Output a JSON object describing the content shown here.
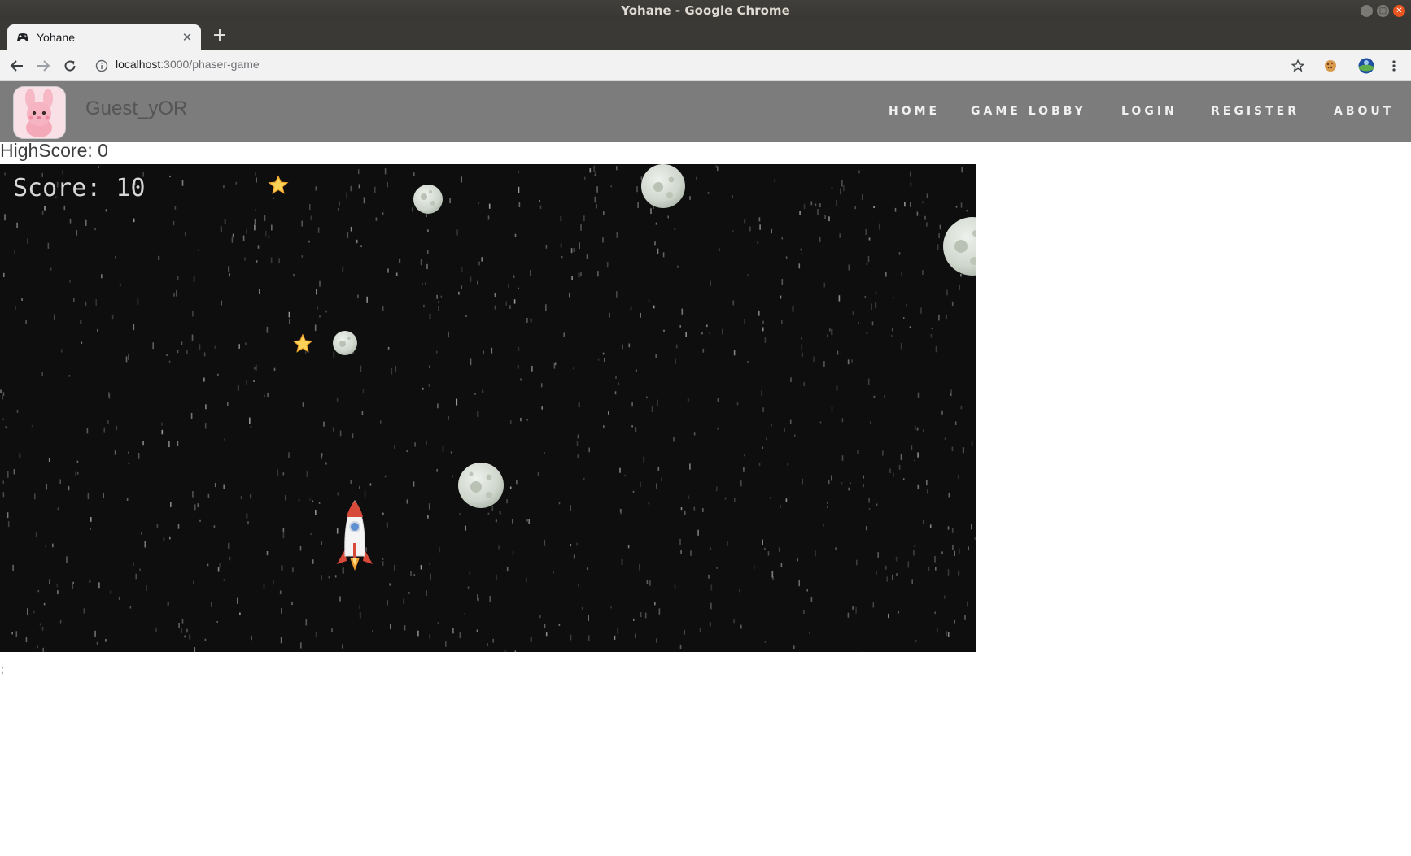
{
  "window": {
    "title": "Yohane - Google Chrome"
  },
  "browser": {
    "tab_title": "Yohane",
    "url_host": "localhost",
    "url_path": ":3000/phaser-game"
  },
  "site": {
    "username": "Guest_yOR",
    "nav": [
      "HOME",
      "GAME LOBBY",
      "LOGIN",
      "REGISTER",
      "ABOUT"
    ]
  },
  "page": {
    "highscore_label": "HighScore: 0",
    "stray_text": ";"
  },
  "game": {
    "score_label": "Score: 10",
    "background_color": "#0e0e0f"
  }
}
